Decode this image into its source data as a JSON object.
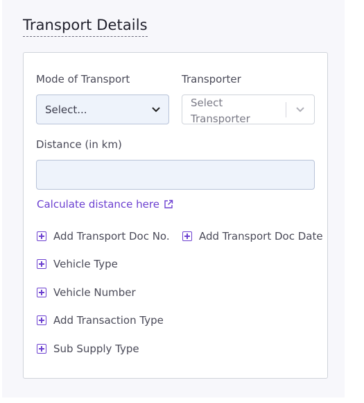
{
  "section": {
    "title": "Transport Details"
  },
  "mode_of_transport": {
    "label": "Mode of Transport",
    "value": "Select..."
  },
  "transporter": {
    "label": "Transporter",
    "placeholder": "Select Transporter"
  },
  "distance": {
    "label": "Distance (in km)",
    "value": ""
  },
  "calculate_link": {
    "label": "Calculate distance here"
  },
  "add_items": [
    {
      "label": "Add Transport Doc No."
    },
    {
      "label": "Add Transport Doc Date"
    },
    {
      "label": "Vehicle Type"
    },
    {
      "label": "Vehicle Number"
    },
    {
      "label": "Add Transaction Type"
    },
    {
      "label": "Sub Supply Type"
    }
  ],
  "colors": {
    "accent": "#6b3fd0",
    "field_bg": "#eef3fb",
    "panel_bg": "#f7f7fb"
  }
}
